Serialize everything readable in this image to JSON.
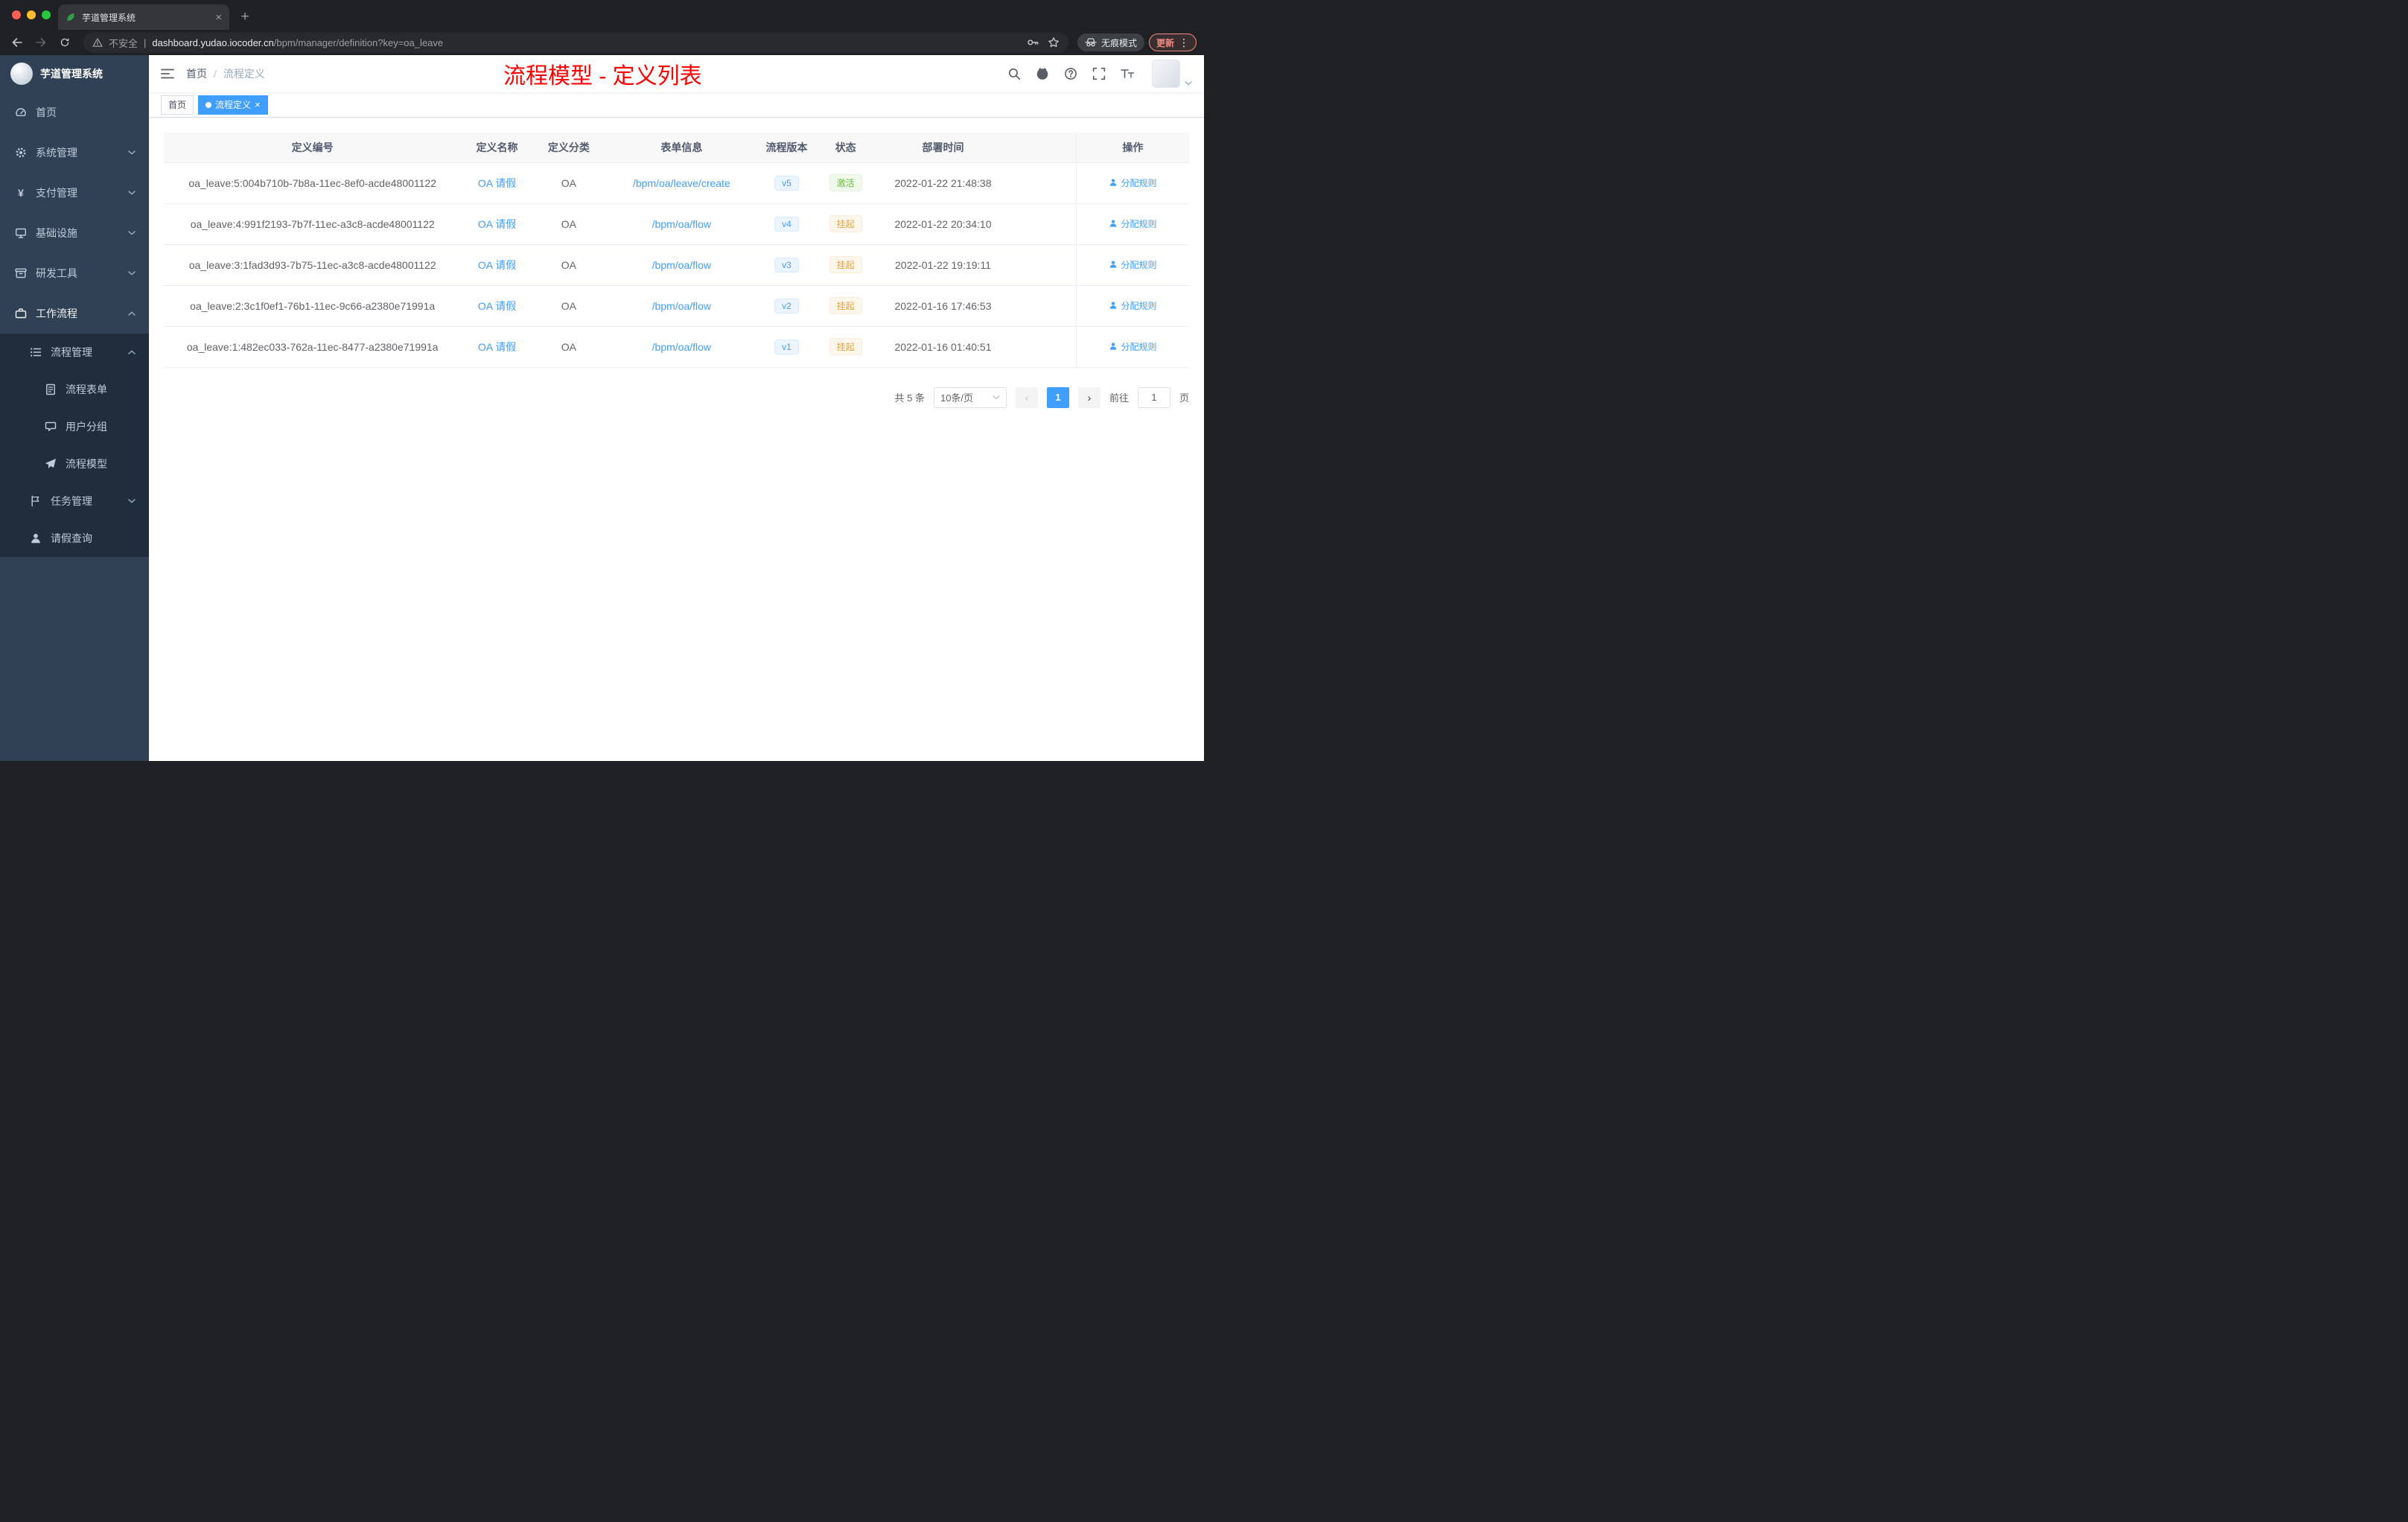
{
  "icons": {
    "close": "×",
    "plus": "+",
    "more": "⋮",
    "yen": "¥",
    "divider": "|",
    "slash": "/",
    "prev": "‹",
    "next": "›"
  },
  "browser": {
    "tab_title": "芋道管理系统",
    "security_label": "不安全",
    "url_domain": "dashboard.yudao.iocoder.cn",
    "url_path": "/bpm/manager/definition?key=oa_leave",
    "incognito_label": "无痕模式",
    "update_label": "更新"
  },
  "sidebar": {
    "logo_title": "芋道管理系统",
    "items": [
      {
        "label": "首页"
      },
      {
        "label": "系统管理"
      },
      {
        "label": "支付管理"
      },
      {
        "label": "基础设施"
      },
      {
        "label": "研发工具"
      },
      {
        "label": "工作流程"
      }
    ],
    "sub": {
      "manage": "流程管理",
      "form": "流程表单",
      "group": "用户分组",
      "model": "流程模型",
      "task": "任务管理",
      "leave": "请假查询"
    }
  },
  "header": {
    "breadcrumb_home": "首页",
    "breadcrumb_current": "流程定义",
    "annotation": "流程模型 - 定义列表"
  },
  "tags": {
    "home": "首页",
    "active": "流程定义"
  },
  "table": {
    "columns": [
      "定义编号",
      "定义名称",
      "定义分类",
      "表单信息",
      "流程版本",
      "状态",
      "部署时间",
      "操作"
    ],
    "rows": [
      {
        "id": "oa_leave:5:004b710b-7b8a-11ec-8ef0-acde48001122",
        "name": "OA 请假",
        "category": "OA",
        "form": "/bpm/oa/leave/create",
        "version": "v5",
        "status": "激活",
        "status_type": "success",
        "time": "2022-01-22 21:48:38",
        "action": "分配规则"
      },
      {
        "id": "oa_leave:4:991f2193-7b7f-11ec-a3c8-acde48001122",
        "name": "OA 请假",
        "category": "OA",
        "form": "/bpm/oa/flow",
        "version": "v4",
        "status": "挂起",
        "status_type": "warning",
        "time": "2022-01-22 20:34:10",
        "action": "分配规则"
      },
      {
        "id": "oa_leave:3:1fad3d93-7b75-11ec-a3c8-acde48001122",
        "name": "OA 请假",
        "category": "OA",
        "form": "/bpm/oa/flow",
        "version": "v3",
        "status": "挂起",
        "status_type": "warning",
        "time": "2022-01-22 19:19:11",
        "action": "分配规则"
      },
      {
        "id": "oa_leave:2:3c1f0ef1-76b1-11ec-9c66-a2380e71991a",
        "name": "OA 请假",
        "category": "OA",
        "form": "/bpm/oa/flow",
        "version": "v2",
        "status": "挂起",
        "status_type": "warning",
        "time": "2022-01-16 17:46:53",
        "action": "分配规则"
      },
      {
        "id": "oa_leave:1:482ec033-762a-11ec-8477-a2380e71991a",
        "name": "OA 请假",
        "category": "OA",
        "form": "/bpm/oa/flow",
        "version": "v1",
        "status": "挂起",
        "status_type": "warning",
        "time": "2022-01-16 01:40:51",
        "action": "分配规则"
      }
    ]
  },
  "pagination": {
    "total": "共 5 条",
    "page_size": "10条/页",
    "current_page": "1",
    "goto_prefix": "前往",
    "goto_value": "1",
    "goto_suffix": "页"
  },
  "colors": {
    "accent": "#409EFF",
    "success": "#67C23A",
    "warning": "#E6A23C",
    "annotation": "#FF0000",
    "sidebar_bg": "#304156",
    "submenu_bg": "#1F2D3D"
  }
}
